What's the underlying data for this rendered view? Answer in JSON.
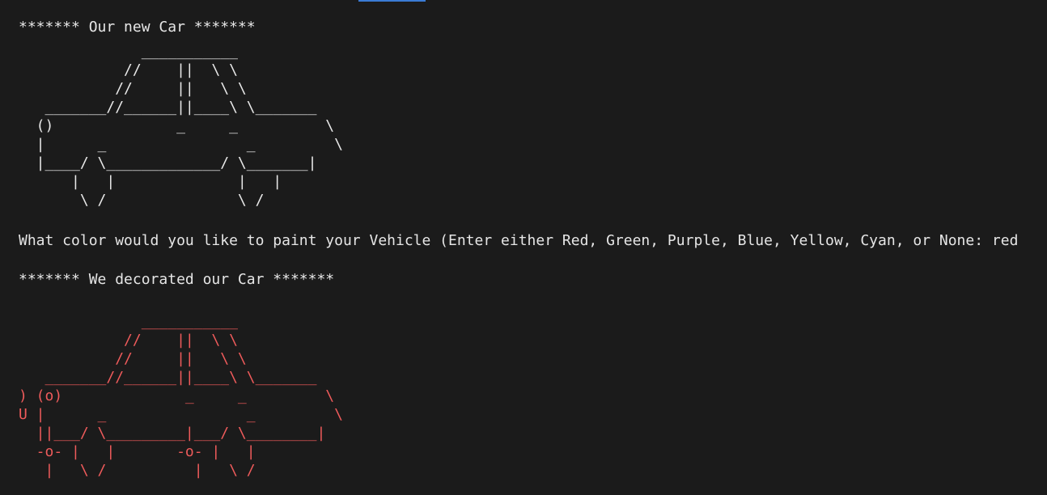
{
  "terminal": {
    "header_new": "******* Our new Car *******",
    "car_plain": "              ___________\n            //    ||  \\ \\\n           //     ||   \\ \\\n   _______//______||____\\ \\_______\n  ()              _     _          \\\n  |      _                _         \\\n  |____/ \\_____________/ \\_______|\n      |   |              |   |\n       \\ /               \\ /",
    "prompt_text": "What color would you like to paint your Vehicle (Enter either Red, Green, Purple, Blue, Yellow, Cyan, or None: red",
    "header_decorated": "******* We decorated our Car *******",
    "car_decorated": "              ___________\n            //    ||  \\ \\\n           //     ||   \\ \\\n   _______//______||____\\ \\_______\n) (o)              _     _         \\\nU |      _                _         \\\n  ||___/ \\_________|___/ \\________|\n  -o- |   |       -o- |   |\n   |   \\ /          |   \\ /",
    "colors": {
      "background": "#1b1b1b",
      "text": "#e6e6e6",
      "red": "#ef5b5b",
      "tab_accent": "#3a7bd5"
    }
  }
}
